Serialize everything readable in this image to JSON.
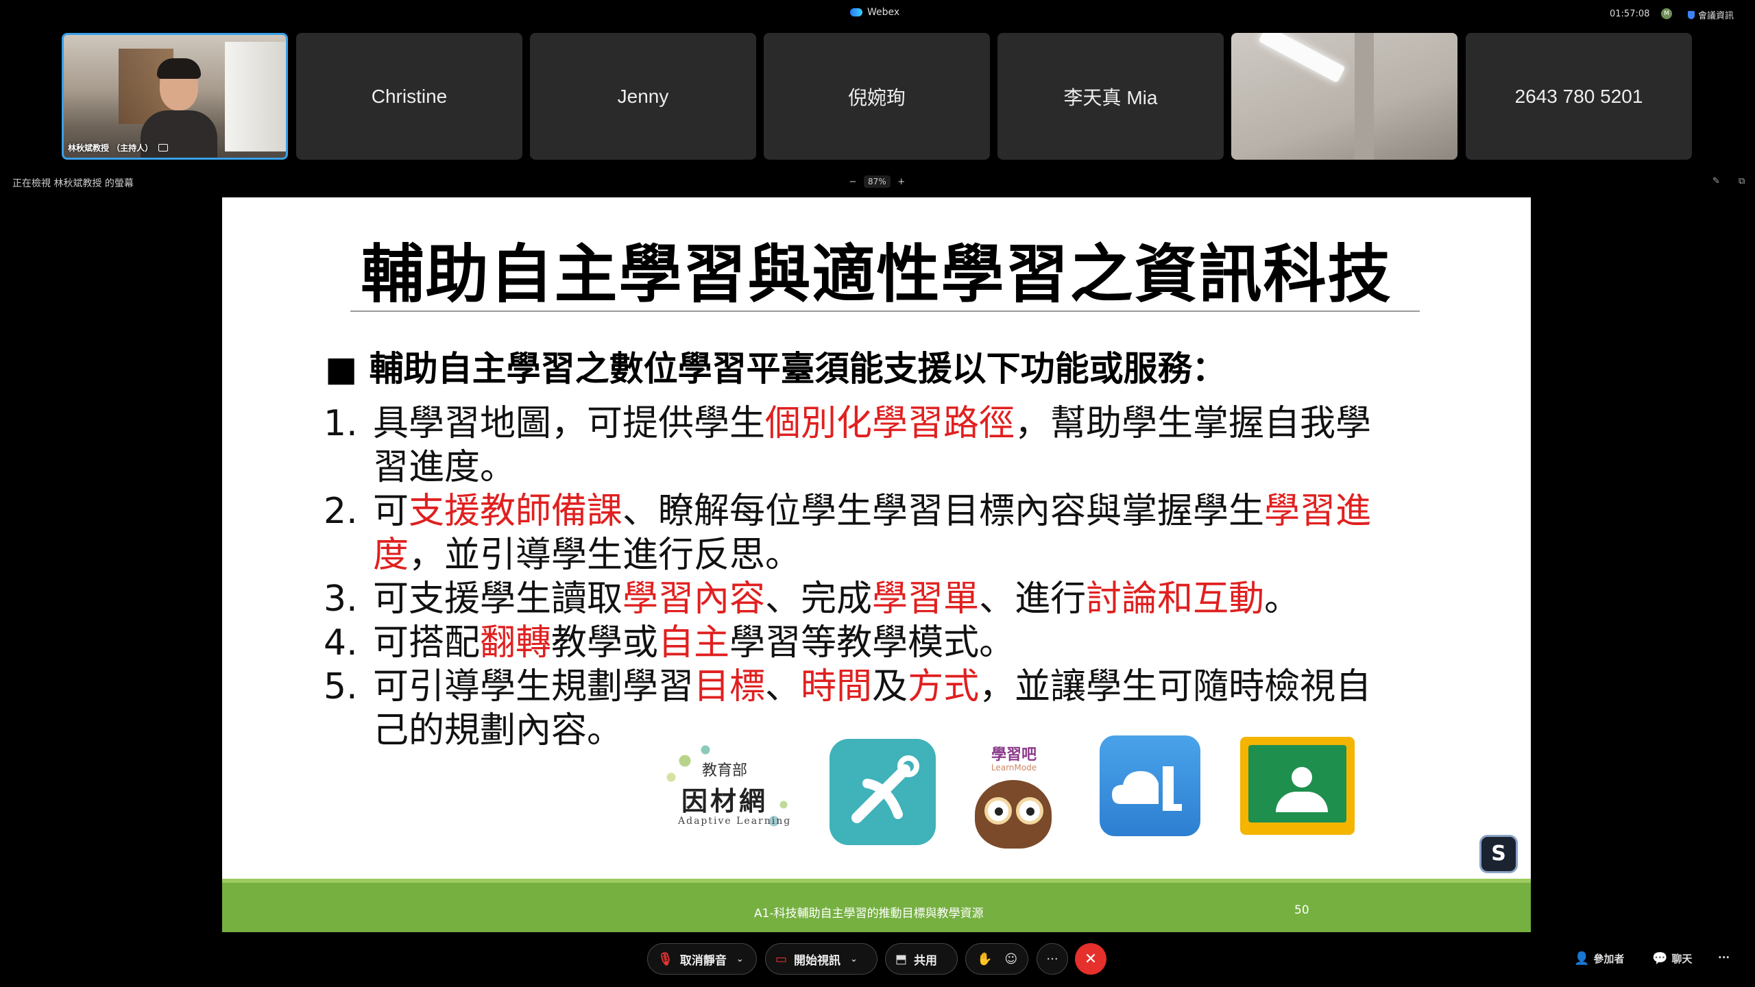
{
  "app": {
    "title": "Webex",
    "clock": "01:57:08",
    "status_initial": "M",
    "meeting_info": "會議資訊"
  },
  "participants": [
    {
      "name": "林秋斌教授 （主持人）",
      "type": "host-video"
    },
    {
      "name": "Christine",
      "type": "name"
    },
    {
      "name": "Jenny",
      "type": "name"
    },
    {
      "name": "倪婉珣",
      "type": "name"
    },
    {
      "name": "李天真 Mia",
      "type": "name"
    },
    {
      "name": "",
      "type": "ceiling-video"
    },
    {
      "name": "2643 780 5201",
      "type": "name"
    }
  ],
  "viewing": {
    "text": "正在檢視 林秋斌教授 的螢幕",
    "zoom_minus": "−",
    "zoom_value": "87%",
    "zoom_plus": "+"
  },
  "slide": {
    "title": "輔助自主學習與適性學習之資訊科技",
    "heading": "■ 輔助自主學習之數位學習平臺須能支援以下功能或服務：",
    "items": [
      {
        "num": "1.",
        "segments": [
          {
            "t": "具學習地圖，可提供學生",
            "red": false
          },
          {
            "t": "個別化學習路徑",
            "red": true
          },
          {
            "t": "，幫助學生掌握自我學習進度。",
            "red": false
          }
        ]
      },
      {
        "num": "2.",
        "segments": [
          {
            "t": "可",
            "red": false
          },
          {
            "t": "支援教師備課",
            "red": true
          },
          {
            "t": "、瞭解每位學生學習目標內容與掌握學生",
            "red": false
          },
          {
            "t": "學習進度",
            "red": true
          },
          {
            "t": "，並引導學生進行反思。",
            "red": false
          }
        ]
      },
      {
        "num": "3.",
        "segments": [
          {
            "t": "可支援學生讀取",
            "red": false
          },
          {
            "t": "學習內容",
            "red": true
          },
          {
            "t": "、完成",
            "red": false
          },
          {
            "t": "學習單",
            "red": true
          },
          {
            "t": "、進行",
            "red": false
          },
          {
            "t": "討論和互動",
            "red": true
          },
          {
            "t": "。",
            "red": false
          }
        ]
      },
      {
        "num": "4.",
        "segments": [
          {
            "t": "可搭配",
            "red": false
          },
          {
            "t": "翻轉",
            "red": true
          },
          {
            "t": "教學或",
            "red": false
          },
          {
            "t": "自主",
            "red": true
          },
          {
            "t": "學習等教學模式。",
            "red": false
          }
        ]
      },
      {
        "num": "5.",
        "segments": [
          {
            "t": "可引導學生規劃學習",
            "red": false
          },
          {
            "t": "目標",
            "red": true
          },
          {
            "t": "、",
            "red": false
          },
          {
            "t": "時間",
            "red": true
          },
          {
            "t": "及",
            "red": false
          },
          {
            "t": "方式",
            "red": true
          },
          {
            "t": "，並讓學生可隨時檢視自己的規劃內容。",
            "red": false
          }
        ]
      }
    ],
    "logo_moe": {
      "line1": "教育部",
      "line2": "因材網",
      "line3": "Adaptive Learning"
    },
    "logo_learnmode": {
      "name": "學習吧",
      "sub": "LearnMode"
    },
    "footer_text": "A1-科技輔助自主學習的推動目標與教學資源",
    "page_number": "50",
    "badge_icon": "slido-s-icon"
  },
  "controls": {
    "mute_label": "取消靜音",
    "video_label": "開始視訊",
    "share_label": "共用",
    "more_label": "···",
    "end_icon": "✕",
    "participants_label": "參加者",
    "chat_label": "聊天",
    "overflow_label": "···"
  },
  "colors": {
    "accent_red": "#e02020",
    "footer_green": "#76b041",
    "end_call": "#e5302b",
    "host_border": "#3aa0e8"
  }
}
